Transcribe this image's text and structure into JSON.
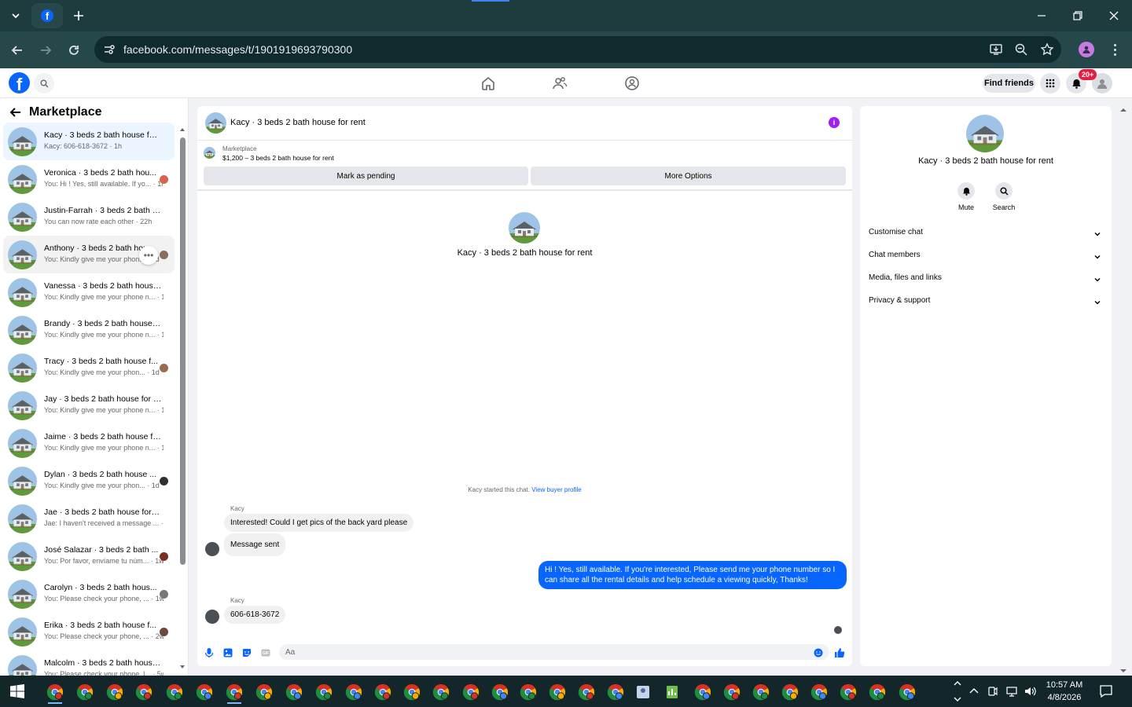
{
  "browser": {
    "url": "facebook.com/messages/t/1901919693790300"
  },
  "fb_header": {
    "find_friends": "Find friends",
    "notification_count": "20+"
  },
  "sidebar": {
    "title": "Marketplace",
    "conversations": [
      {
        "name": "Kacy · 3 beds 2 bath house for ...",
        "snippet": "Kacy: 606-618-3672 · 1h",
        "state": "active"
      },
      {
        "name": "Veronica · 3 beds 2 bath hou...",
        "snippet": "You: Hi ! Yes, still available. If yo... · 1h",
        "state": "",
        "receipt": "#d9634a"
      },
      {
        "name": "Justin-Farrah · 3 beds 2 bath h...",
        "snippet": "You can now rate each other · 22h",
        "state": ""
      },
      {
        "name": "Anthony · 3 beds 2 bath hou...",
        "snippet": "You: Kindly give me your phon... · 1d",
        "state": "hover",
        "receipt": "#8a6d5a"
      },
      {
        "name": "Vanessa · 3 beds 2 bath house f...",
        "snippet": "You: Kindly give me your phone n... · 1d",
        "state": ""
      },
      {
        "name": "Brandy · 3 beds 2 bath house f...",
        "snippet": "You: Kindly give me your phone n... · 1d",
        "state": ""
      },
      {
        "name": "Tracy · 3 beds 2 bath house f...",
        "snippet": "You: Kindly give me your phon... · 1d",
        "state": "",
        "receipt": "#9a6b4d"
      },
      {
        "name": "Jay · 3 beds 2 bath house for re...",
        "snippet": "You: Kindly give me your phone n... · 1d",
        "state": ""
      },
      {
        "name": "Jaime · 3 beds 2 bath house for...",
        "snippet": "You: Kindly give me your phone n... · 1d",
        "state": ""
      },
      {
        "name": "Dylan · 3 beds 2 bath house ...",
        "snippet": "You: Kindly give me your phon... · 1d",
        "state": "",
        "receipt": "#2f2f2f"
      },
      {
        "name": "Jae · 3 beds 2 bath house for re...",
        "snippet": "Jae: I haven't received a message ... · 4d",
        "state": ""
      },
      {
        "name": "José Salazar · 3 beds 2 bath ...",
        "snippet": "You: Por favor, envíame tu núm... · 1w",
        "state": "",
        "receipt": "#7a2e1e"
      },
      {
        "name": "Carolyn · 3 beds 2 bath hous...",
        "snippet": "You: Please check your phone, ... · 1w",
        "state": "",
        "receipt": "#777777"
      },
      {
        "name": "Erika · 3 beds 2 bath house f...",
        "snippet": "You: Please check your phone, ... · 2w",
        "state": "",
        "receipt": "#6b4a3a"
      },
      {
        "name": "Malcolm · 3 beds 2 bath house ...",
        "snippet": "You: Please check your phone, l... · 5w",
        "state": ""
      }
    ]
  },
  "chat": {
    "title": "Kacy · 3 beds 2 bath house for rent",
    "marketplace_label": "Marketplace",
    "listing": "$1,200 – 3 beds 2 bath house for rent",
    "mark_pending": "Mark as pending",
    "more_options": "More Options",
    "profile_name": "Kacy · 3 beds 2 bath house for rent",
    "started_text": "Kacy started this chat.",
    "view_buyer": "View buyer profile",
    "messages": {
      "sender1": "Kacy",
      "m1": "Interested! Could I get pics of the back yard please",
      "m2": "Message sent",
      "m3_line1": "Hi ! Yes, still available. If you're interested, Please send me your phone number so I",
      "m3_line2": "can share all the rental details and help schedule a viewing quickly, Thanks!",
      "sender2": "Kacy",
      "m4": "606-618-3672"
    },
    "input_placeholder": "Aa"
  },
  "right_panel": {
    "name": "Kacy · 3 beds 2 bath house for rent",
    "mute": "Mute",
    "search": "Search",
    "sections": [
      "Customise chat",
      "Chat members",
      "Media, files and links",
      "Privacy & support"
    ]
  },
  "taskbar": {
    "time": "10:57 AM",
    "date": "4/8/2026"
  },
  "colors": {
    "fb_blue": "#0866ff",
    "chrome_dark": "#1e3b3e"
  }
}
